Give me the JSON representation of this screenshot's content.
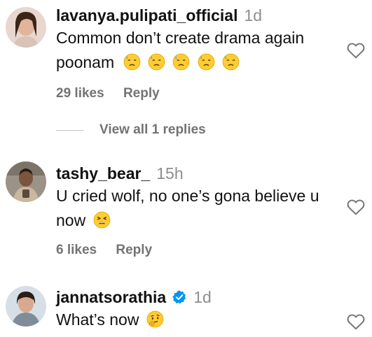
{
  "comments": [
    {
      "username": "lavanya.pulipati_official",
      "time": "1d",
      "text_line1": "Common don’t create drama again",
      "text_line2": "poonam",
      "emoji_icons": [
        "downcast-face-with-sweat-icon",
        "downcast-face-with-sweat-icon",
        "downcast-face-with-sweat-icon",
        "downcast-face-with-sweat-icon",
        "downcast-face-with-sweat-icon"
      ],
      "likes": "29 likes",
      "reply": "Reply",
      "view_replies": "View all 1 replies"
    },
    {
      "username": "tashy_bear_",
      "time": "15h",
      "text_line1": "U cried wolf, no one’s gona believe u",
      "text_line2": "now",
      "emoji_icons": [
        "weary-face-icon"
      ],
      "likes": "6 likes",
      "reply": "Reply"
    },
    {
      "username": "jannatsorathia",
      "verified": true,
      "time": "1d",
      "text_line1": "What’s now",
      "emoji_icons": [
        "thinking-face-icon"
      ]
    }
  ],
  "colors": {
    "username": "#111111",
    "secondary": "#8e8e8e",
    "verified": "#0095f6",
    "emoji": "#ffcc33"
  }
}
